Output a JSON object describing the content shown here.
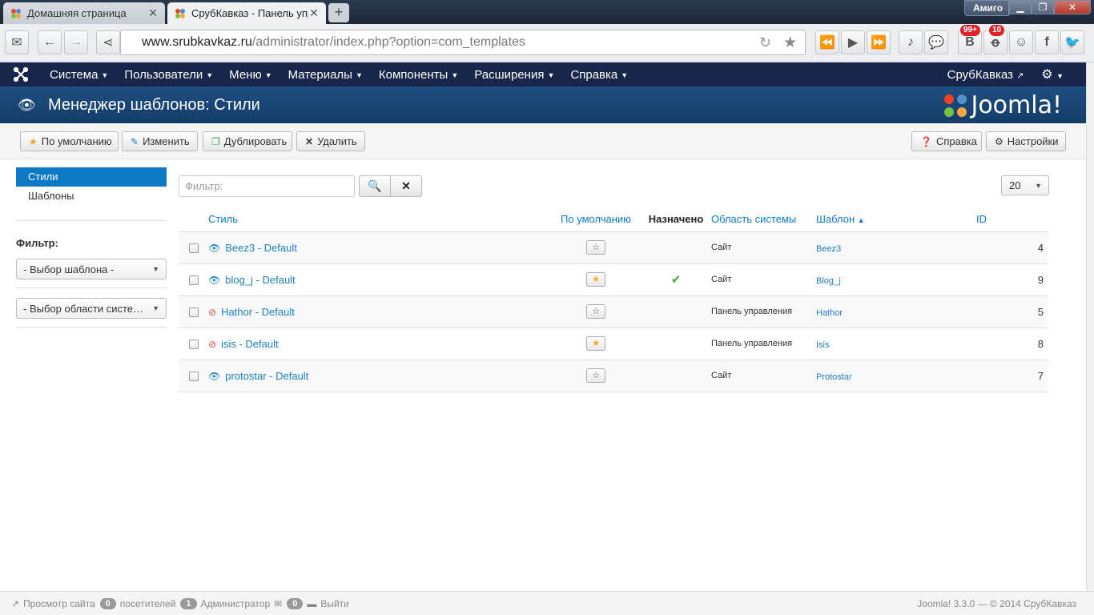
{
  "browser": {
    "tabs": [
      {
        "title": "Домашняя страница"
      },
      {
        "title": "СрубКавказ - Панель упра"
      }
    ],
    "profile": "Амиго",
    "url_host": "www.srubkavkaz.ru",
    "url_path": "/administrator/index.php?option=com_templates",
    "badge_vk": "99+",
    "badge_ok": "10"
  },
  "nav": {
    "items": [
      {
        "label": "Система"
      },
      {
        "label": "Пользователи"
      },
      {
        "label": "Меню"
      },
      {
        "label": "Материалы"
      },
      {
        "label": "Компоненты"
      },
      {
        "label": "Расширения"
      },
      {
        "label": "Справка"
      }
    ],
    "site_name": "СрубКавказ"
  },
  "header": {
    "title": "Менеджер шаблонов: Стили",
    "brand": "Joomla!"
  },
  "toolbar": {
    "default_label": "По умолчанию",
    "edit_label": "Изменить",
    "duplicate_label": "Дублировать",
    "delete_label": "Удалить",
    "help_label": "Справка",
    "options_label": "Настройки"
  },
  "sidebar": {
    "items": [
      {
        "label": "Стили"
      },
      {
        "label": "Шаблоны"
      }
    ],
    "filter_label": "Фильтр:",
    "template_select": "- Выбор шаблона -",
    "client_select": "- Выбор области систе…"
  },
  "search": {
    "placeholder": "Фильтр:",
    "limit": "20"
  },
  "table": {
    "headers": {
      "style": "Стиль",
      "default": "По умолчанию",
      "assigned": "Назначено",
      "client": "Область системы",
      "template": "Шаблон",
      "id": "ID"
    },
    "rows": [
      {
        "style": "Beez3 - Default",
        "client": "Сайт",
        "template": "Beez3",
        "id": "4"
      },
      {
        "style": "blog_j - Default",
        "client": "Сайт",
        "template": "Blog_j",
        "id": "9"
      },
      {
        "style": "Hathor - Default",
        "client": "Панель управления",
        "template": "Hathor",
        "id": "5"
      },
      {
        "style": "isis - Default",
        "client": "Панель управления",
        "template": "Isis",
        "id": "8"
      },
      {
        "style": "protostar - Default",
        "client": "Сайт",
        "template": "Protostar",
        "id": "7"
      }
    ]
  },
  "status": {
    "view_site": "Просмотр сайта",
    "visitors_count": "0",
    "visitors_label": "посетителей",
    "admins_count": "1",
    "admins_label": "Администратор",
    "messages_count": "0",
    "logout": "Выйти",
    "copyright": "Joomla! 3.3.0 — © 2014 СрубКавказ"
  }
}
